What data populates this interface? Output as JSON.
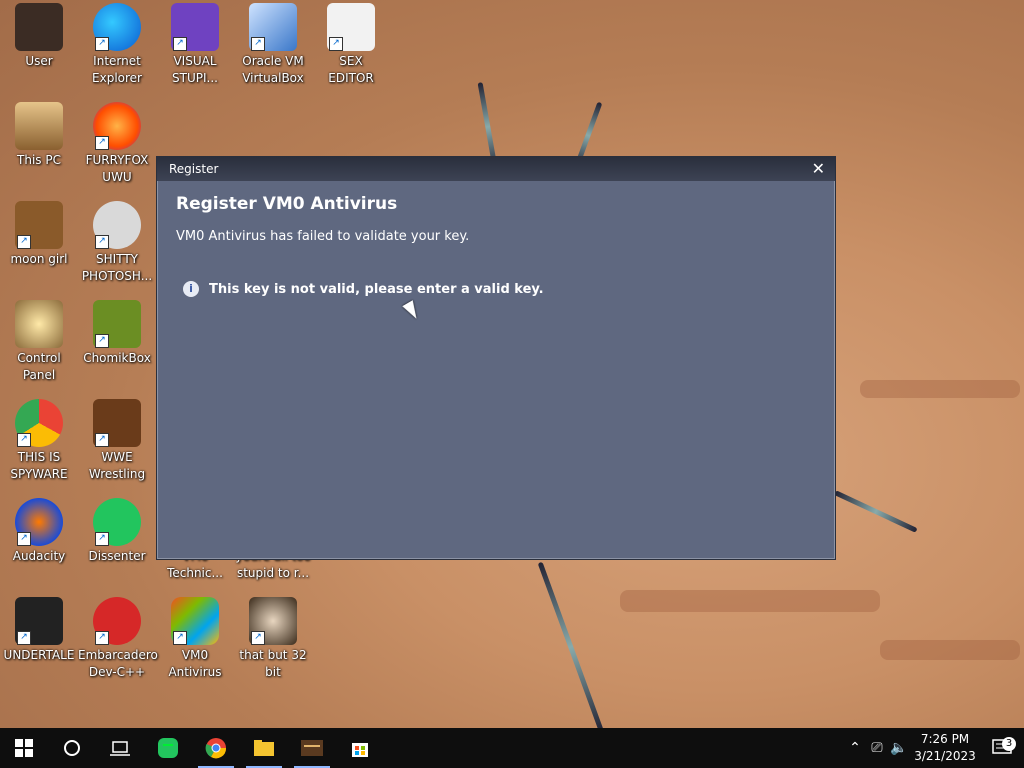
{
  "desktop_icons": [
    {
      "label": "User"
    },
    {
      "label": "Internet\nExplorer"
    },
    {
      "label": "VISUAL\nSTUPI..."
    },
    {
      "label": "Oracle VM\nVirtualBox"
    },
    {
      "label": "SEX\nEDITOR"
    },
    {
      "label": "This PC"
    },
    {
      "label": "FURRYFOX\nUWU"
    },
    {
      "label": "moon girl"
    },
    {
      "label": "SHITTY\nPHOTOSH..."
    },
    {
      "label": "Control Panel"
    },
    {
      "label": "ChomikBox"
    },
    {
      "label": "THIS IS\nSPYWARE"
    },
    {
      "label": "WWE\nWrestling"
    },
    {
      "label": "Audacity"
    },
    {
      "label": "Dissenter"
    },
    {
      "label": "VM0\nTechnic..."
    },
    {
      "label": "youre all too\nstupid to r..."
    },
    {
      "label": "UNDERTALE"
    },
    {
      "label": "Embarcadero\nDev-C++"
    },
    {
      "label": "VM0\nAntivirus"
    },
    {
      "label": "that but 32\nbit"
    }
  ],
  "dialog": {
    "title": "Register",
    "close_glyph": "✕",
    "heading": "Register VM0 Antivirus",
    "subtitle": "VM0 Antivirus has failed to validate your key.",
    "message": "This key is not valid, please enter a valid key."
  },
  "taskbar": {
    "time": "7:26 PM",
    "date": "3/21/2023",
    "notification_count": "3"
  }
}
